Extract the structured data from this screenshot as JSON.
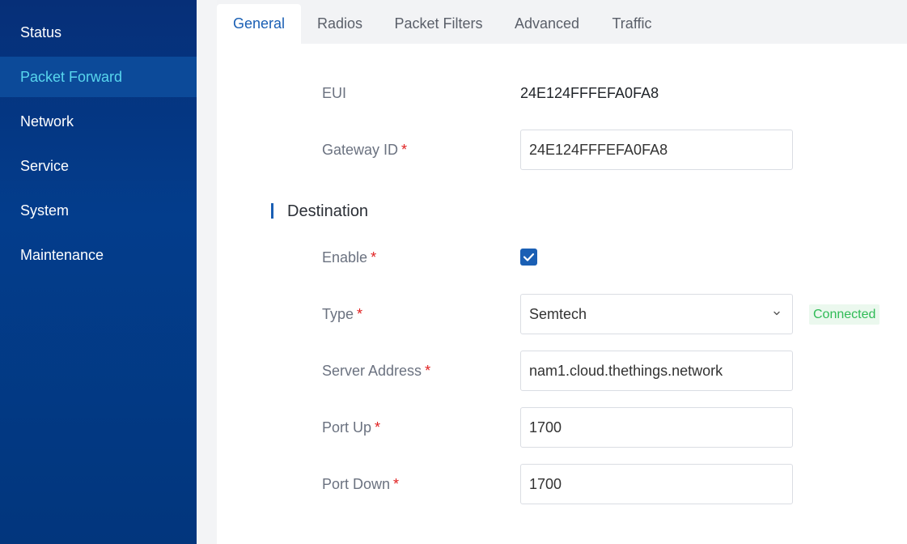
{
  "sidebar": {
    "items": [
      {
        "label": "Status"
      },
      {
        "label": "Packet Forward"
      },
      {
        "label": "Network"
      },
      {
        "label": "Service"
      },
      {
        "label": "System"
      },
      {
        "label": "Maintenance"
      }
    ],
    "active": "Packet Forward"
  },
  "tabs": [
    {
      "label": "General"
    },
    {
      "label": "Radios"
    },
    {
      "label": "Packet Filters"
    },
    {
      "label": "Advanced"
    },
    {
      "label": "Traffic"
    }
  ],
  "active_tab": "General",
  "general": {
    "eui": {
      "label": "EUI",
      "value": "24E124FFFEFA0FA8"
    },
    "gateway_id": {
      "label": "Gateway ID",
      "required": "*",
      "value": "24E124FFFEFA0FA8"
    }
  },
  "destination": {
    "title": "Destination",
    "enable": {
      "label": "Enable",
      "required": "*",
      "checked": true
    },
    "type": {
      "label": "Type",
      "required": "*",
      "value": "Semtech",
      "status": "Connected"
    },
    "server_address": {
      "label": "Server Address",
      "required": "*",
      "value": "nam1.cloud.thethings.network"
    },
    "port_up": {
      "label": "Port Up",
      "required": "*",
      "value": "1700"
    },
    "port_down": {
      "label": "Port Down",
      "required": "*",
      "value": "1700"
    }
  },
  "colors": {
    "sidebar_bg": "#033d8c",
    "active_nav_text": "#58d6ee",
    "accent": "#1a5fb4",
    "required": "#e02020",
    "connected": "#2fbb56"
  },
  "icons": {
    "select_arrow": "chevron-down-icon",
    "checkbox_mark": "check-icon"
  }
}
